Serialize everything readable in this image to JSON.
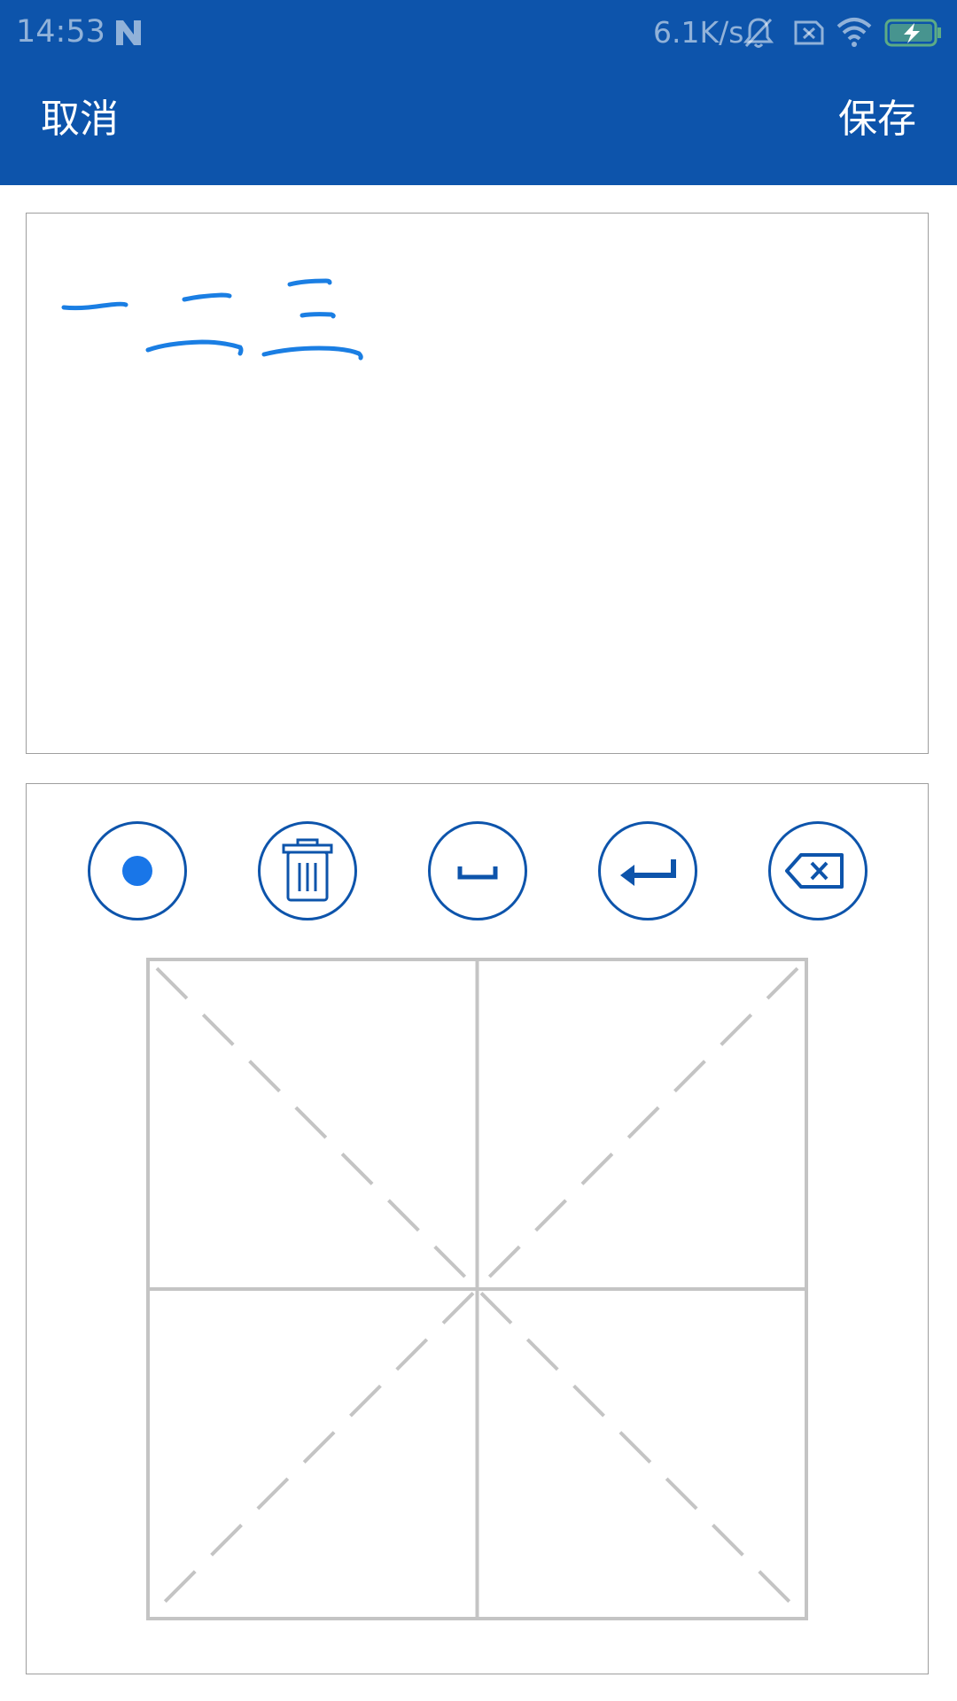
{
  "status_bar": {
    "time": "14:53",
    "network_speed": "6.1K/s",
    "icons": [
      "n-icon",
      "bell-muted-icon",
      "sim-x-icon",
      "wifi-icon",
      "battery-charging-icon"
    ]
  },
  "app_bar": {
    "cancel_label": "取消",
    "save_label": "保存"
  },
  "writing_area": {
    "strokes_description_colors": {
      "ink": "#1a7ee3"
    }
  },
  "toolbar": {
    "buttons": [
      {
        "name": "pen-size",
        "icon": "dot-icon"
      },
      {
        "name": "clear",
        "icon": "trash-icon"
      },
      {
        "name": "space",
        "icon": "space-icon"
      },
      {
        "name": "enter",
        "icon": "enter-icon"
      },
      {
        "name": "delete",
        "icon": "backspace-icon"
      }
    ]
  },
  "colors": {
    "primary": "#0d54ab",
    "ink": "#1a7ee3",
    "dot": "#1976e8",
    "grid": "#c4c4c4",
    "border": "#9e9e9e"
  }
}
